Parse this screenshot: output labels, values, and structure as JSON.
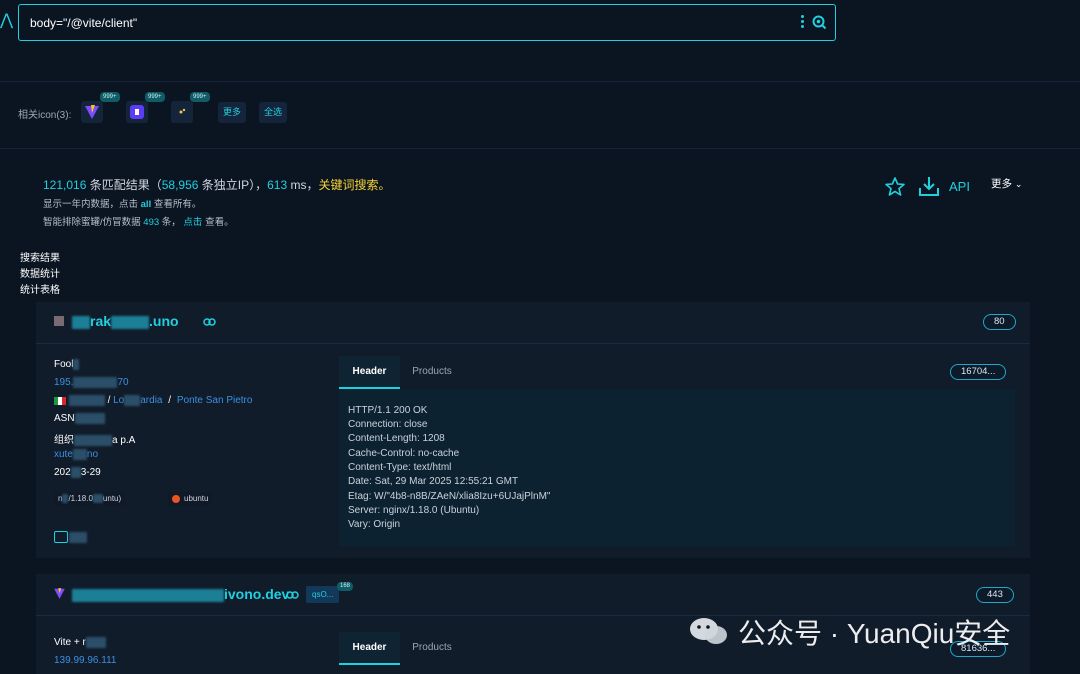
{
  "search": {
    "query": "body=\"/@vite/client\""
  },
  "icon_row": {
    "label": "相关icon(3):",
    "badges": [
      "999+",
      "999+",
      "999+"
    ],
    "more_label": "更多",
    "select_all_label": "全选"
  },
  "summary": {
    "count": "121,016",
    "count_suffix": " 条匹配结果（",
    "ip_count": "58,956",
    "ip_suffix": " 条独立IP），",
    "time": "613",
    "time_unit": " ms，",
    "keyword_link": "关键词搜索。",
    "line2_prefix": "显示一年内数据，点击 ",
    "line2_all": "all",
    "line2_suffix": " 查看所有。",
    "line3_prefix": "智能排除蜜罐/仿冒数据 ",
    "line3_count": "493",
    "line3_mid": " 条，  ",
    "line3_link": "点击",
    "line3_suffix": " 查看。"
  },
  "toolbar": {
    "api_label": "API",
    "more_label": "更多"
  },
  "side_nav": [
    "搜索结果",
    "数据统计",
    "统计表格"
  ],
  "results": [
    {
      "title_visible": "rak",
      "title_suffix": ".uno",
      "port": "80",
      "info": {
        "name": "Fool",
        "ip_prefix": "195.",
        "ip_suffix": "70",
        "region": "Lo",
        "region_tail": "ardia",
        "sep": "/",
        "city": "Ponte San Pietro",
        "asn": "ASN",
        "org_label": "组织",
        "org_tail": "a p.A",
        "domain_prefix": "xute",
        "domain_suffix": "no",
        "date_prefix": "202",
        "date_suffix": "3-29",
        "server_tag_prefix": "n",
        "server_tag_mid": "/1.18.0",
        "server_tag_tail": "untu)",
        "os_tag": "ubuntu"
      },
      "tabs": [
        "Header",
        "Products"
      ],
      "hash_badge": "16704...",
      "header_lines": [
        "HTTP/1.1 200 OK",
        "Connection: close",
        "Content-Length: 1208",
        "Cache-Control: no-cache",
        "Content-Type: text/html",
        "Date: Sat, 29 Mar 2025 12:55:21 GMT",
        "Etag: W/\"4b8-n8B/ZAeN/xlia8Izu+6UJajPlnM\"",
        "Server: nginx/1.18.0 (Ubuntu)",
        "Vary: Origin"
      ]
    },
    {
      "title_visible": "ivono.dev",
      "port": "443",
      "tag": "qsO...",
      "tag_badge": "168",
      "info": {
        "name": "Vite + r",
        "ip": "139.99.96.111"
      },
      "tabs": [
        "Header",
        "Products"
      ],
      "hash_badge": "81636..."
    }
  ],
  "watermark": "公众号 · YuanQiu安全",
  "colors": {
    "accent": "#1fd0df",
    "background": "#0b1421",
    "card": "#111c2b",
    "link": "#3c8fe0",
    "keyword": "#f5d233"
  }
}
